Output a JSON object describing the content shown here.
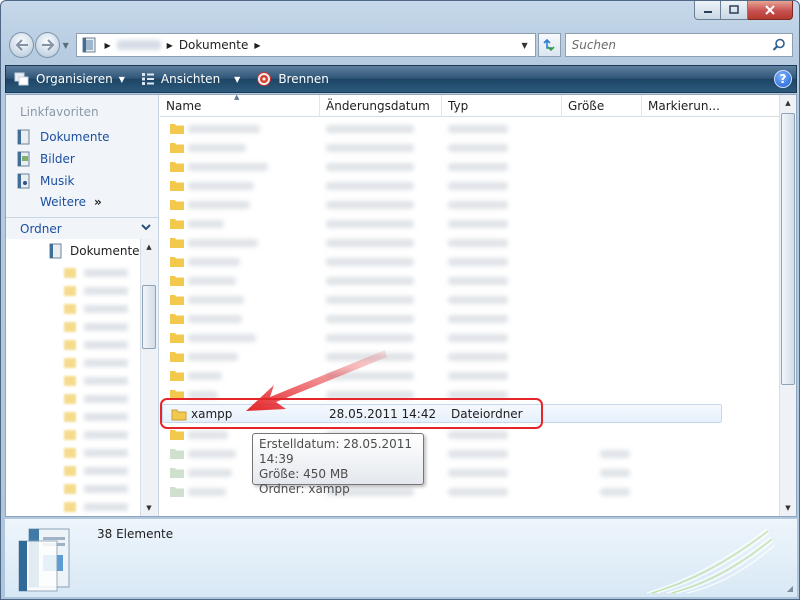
{
  "address": {
    "crumbs": [
      "Dokumente"
    ]
  },
  "search": {
    "placeholder": "Suchen"
  },
  "toolbar": {
    "organize": "Organisieren",
    "views": "Ansichten",
    "burn": "Brennen",
    "help": "?"
  },
  "nav": {
    "favorites_header": "Linkfavoriten",
    "favorites": [
      "Dokumente",
      "Bilder",
      "Musik"
    ],
    "more": "Weitere",
    "more_arrows": "»",
    "folders_header": "Ordner",
    "tree_selected": "Dokumente"
  },
  "columns": {
    "name": "Name",
    "date": "Änderungsdatum",
    "type": "Typ",
    "size": "Größe",
    "tags": "Markierun..."
  },
  "selected_file": {
    "name": "xampp",
    "date": "28.05.2011 14:42",
    "type": "Dateiordner"
  },
  "tooltip": {
    "line1": "Erstelldatum: 28.05.2011 14:39",
    "line2": "Größe: 450 MB",
    "line3": "Ordner: xampp"
  },
  "status": {
    "count": "38 Elemente"
  },
  "colors": {
    "link": "#1b4fa1",
    "highlight_border": "#e4262a",
    "arrow": "#e4262a",
    "folder": "#f2c94c"
  }
}
